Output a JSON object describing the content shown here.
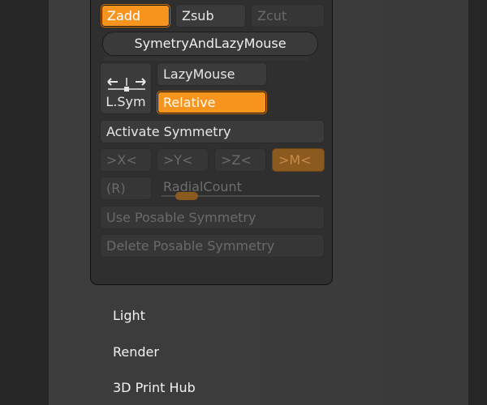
{
  "brush_modes": {
    "zadd": "Zadd",
    "zsub": "Zsub",
    "zcut": "Zcut"
  },
  "symmetry_lazy_mouse_label": "SymetryAndLazyMouse",
  "lazy_mouse": {
    "lsym_label": "L.Sym",
    "lazymouse_label": "LazyMouse",
    "relative_label": "Relative"
  },
  "symmetry": {
    "activate_label": "Activate Symmetry",
    "x_label": ">X<",
    "y_label": ">Y<",
    "z_label": ">Z<",
    "m_label": ">M<",
    "r_label": "(R)",
    "radial_count_label": "RadialCount",
    "radial_count_value": 0.08,
    "use_posable_label": "Use Posable Symmetry",
    "delete_posable_label": "Delete Posable Symmetry"
  },
  "menu": {
    "items": [
      "Light",
      "Render",
      "3D Print Hub"
    ]
  },
  "colors": {
    "accent": "#f7941d",
    "accent_dim": "#8a5a1f",
    "panel_bg": "#2f2f2f",
    "menu_bg": "#3b3b3b"
  }
}
